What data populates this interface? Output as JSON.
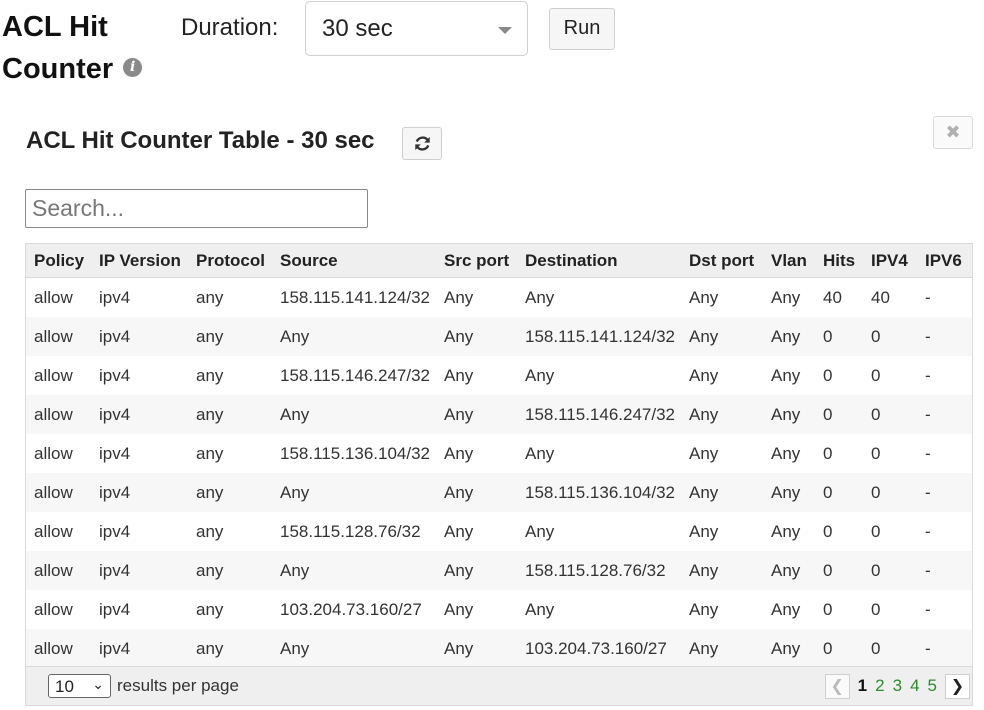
{
  "header": {
    "title_line1": "ACL Hit",
    "title_line2": "Counter",
    "info_icon": "info-icon",
    "duration_label": "Duration:",
    "duration_value": "30 sec",
    "run_label": "Run"
  },
  "panel": {
    "title": "ACL Hit Counter Table - 30 sec",
    "refresh_icon": "refresh-icon",
    "close_icon": "close-icon",
    "close_glyph": "✖",
    "search_placeholder": "Search..."
  },
  "table": {
    "columns": [
      "Policy",
      "IP Version",
      "Protocol",
      "Source",
      "Src port",
      "Destination",
      "Dst port",
      "Vlan",
      "Hits",
      "IPV4",
      "IPV6"
    ],
    "rows": [
      [
        "allow",
        "ipv4",
        "any",
        "158.115.141.124/32",
        "Any",
        "Any",
        "Any",
        "Any",
        "40",
        "40",
        "-"
      ],
      [
        "allow",
        "ipv4",
        "any",
        "Any",
        "Any",
        "158.115.141.124/32",
        "Any",
        "Any",
        "0",
        "0",
        "-"
      ],
      [
        "allow",
        "ipv4",
        "any",
        "158.115.146.247/32",
        "Any",
        "Any",
        "Any",
        "Any",
        "0",
        "0",
        "-"
      ],
      [
        "allow",
        "ipv4",
        "any",
        "Any",
        "Any",
        "158.115.146.247/32",
        "Any",
        "Any",
        "0",
        "0",
        "-"
      ],
      [
        "allow",
        "ipv4",
        "any",
        "158.115.136.104/32",
        "Any",
        "Any",
        "Any",
        "Any",
        "0",
        "0",
        "-"
      ],
      [
        "allow",
        "ipv4",
        "any",
        "Any",
        "Any",
        "158.115.136.104/32",
        "Any",
        "Any",
        "0",
        "0",
        "-"
      ],
      [
        "allow",
        "ipv4",
        "any",
        "158.115.128.76/32",
        "Any",
        "Any",
        "Any",
        "Any",
        "0",
        "0",
        "-"
      ],
      [
        "allow",
        "ipv4",
        "any",
        "Any",
        "Any",
        "158.115.128.76/32",
        "Any",
        "Any",
        "0",
        "0",
        "-"
      ],
      [
        "allow",
        "ipv4",
        "any",
        "103.204.73.160/27",
        "Any",
        "Any",
        "Any",
        "Any",
        "0",
        "0",
        "-"
      ],
      [
        "allow",
        "ipv4",
        "any",
        "Any",
        "Any",
        "103.204.73.160/27",
        "Any",
        "Any",
        "0",
        "0",
        "-"
      ]
    ]
  },
  "footer": {
    "per_page_value": "10",
    "per_page_label": "results per page",
    "pages": [
      "1",
      "2",
      "3",
      "4",
      "5"
    ],
    "current_page": "1",
    "prev_icon": "chevron-left-icon",
    "next_icon": "chevron-right-icon"
  }
}
